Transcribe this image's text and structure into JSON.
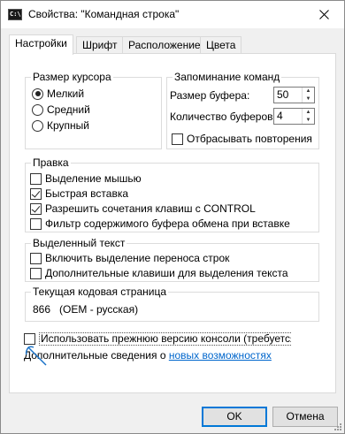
{
  "window": {
    "title": "Свойства: \"Командная строка\"",
    "app_icon_text": "C:\\"
  },
  "tabs": [
    "Настройки",
    "Шрифт",
    "Расположение",
    "Цвета"
  ],
  "cursor_group": {
    "title": "Размер курсора",
    "options": [
      "Мелкий",
      "Средний",
      "Крупный"
    ],
    "selected": "Мелкий"
  },
  "history_group": {
    "title": "Запоминание команд",
    "buffer_size_label": "Размер буфера:",
    "buffer_size_value": "50",
    "buffer_count_label": "Количество буферов:",
    "buffer_count_value": "4",
    "discard_duplicates_label": "Отбрасывать повторения",
    "discard_duplicates_checked": false
  },
  "edit_group": {
    "title": "Правка",
    "items": [
      {
        "label": "Выделение мышью",
        "checked": false
      },
      {
        "label": "Быстрая вставка",
        "checked": true
      },
      {
        "label": "Разрешить сочетания клавиш с CONTROL",
        "checked": true
      },
      {
        "label": "Фильтр содержимого буфера обмена при вставке",
        "checked": false
      }
    ]
  },
  "selection_group": {
    "title": "Выделенный текст",
    "items": [
      {
        "label": "Включить выделение переноса строк",
        "checked": false
      },
      {
        "label": "Дополнительные клавиши для выделения текста",
        "checked": false
      }
    ]
  },
  "codepage_group": {
    "title": "Текущая кодовая страница",
    "value": "866   (OEM - русская)"
  },
  "legacy": {
    "label": "Использовать прежнюю версию консоли (требуется пе",
    "checked": false
  },
  "more_info": {
    "prefix": "Дополнительные сведения о ",
    "link": "новых возможностях"
  },
  "buttons": {
    "ok": "OK",
    "cancel": "Отмена"
  }
}
